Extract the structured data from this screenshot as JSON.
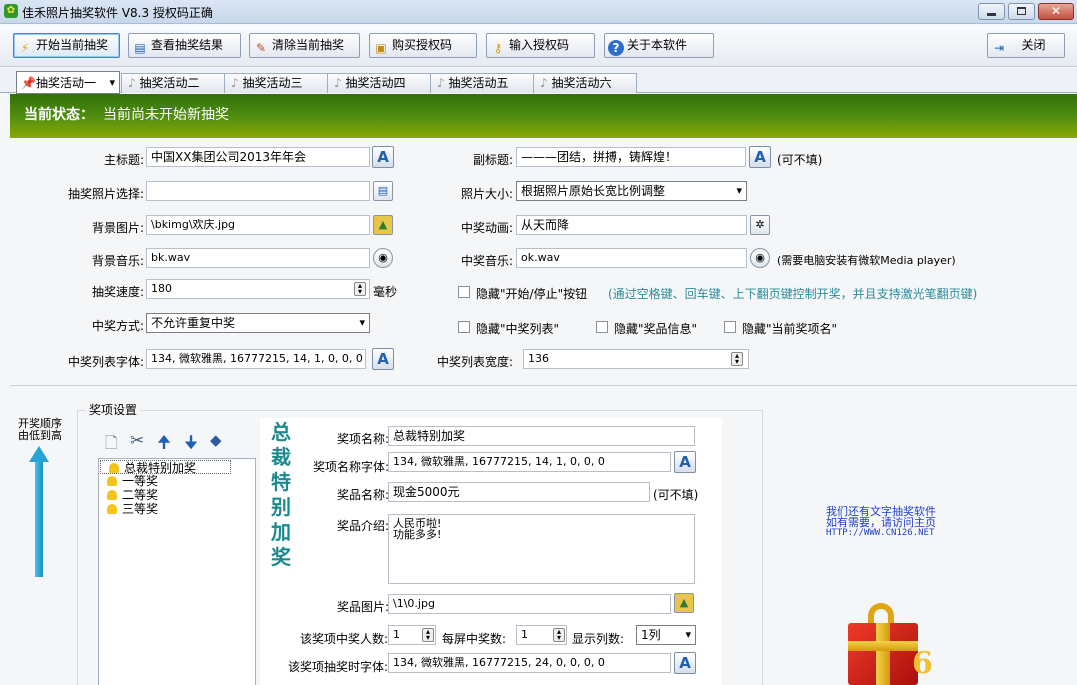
{
  "window": {
    "title": "佳禾照片抽奖软件 V8.3 授权码正确"
  },
  "toolbar": {
    "start": "开始当前抽奖",
    "view": "查看抽奖结果",
    "clear": "清除当前抽奖",
    "buy": "购买授权码",
    "enter": "输入授权码",
    "about": "关于本软件",
    "close": "关闭"
  },
  "tabs": [
    "抽奖活动一",
    "抽奖活动二",
    "抽奖活动三",
    "抽奖活动四",
    "抽奖活动五",
    "抽奖活动六"
  ],
  "status": {
    "label": "当前状态：",
    "value": "当前尚未开始新抽奖"
  },
  "form": {
    "main_title_label": "主标题:",
    "main_title": "中国XX集团公司2013年年会",
    "subtitle_label": "副标题:",
    "subtitle": "———团结，拼搏，铸辉煌！",
    "optional": "(可不填)",
    "photo_select_label": "抽奖照片选择:",
    "photo_select": "",
    "photo_size_label": "照片大小:",
    "photo_size": "根据照片原始长宽比例调整",
    "bg_image_label": "背景图片:",
    "bg_image": "\\bkimg\\欢庆.jpg",
    "anim_label": "中奖动画:",
    "anim": "从天而降",
    "bg_music_label": "背景音乐:",
    "bg_music": "bk.wav",
    "win_music_label": "中奖音乐:",
    "win_music": "ok.wav",
    "win_music_note": "(需要电脑安装有微软Media player)",
    "speed_label": "抽奖速度:",
    "speed": "180",
    "speed_unit": "毫秒",
    "hide_startstop": "隐藏\"开始/停止\"按钮",
    "hide_startstop_note": "(通过空格键、回车键、上下翻页键控制开奖，并且支持激光笔翻页键)",
    "win_mode_label": "中奖方式:",
    "win_mode": "不允许重复中奖",
    "hide_list": "隐藏\"中奖列表\"",
    "hide_prize_info": "隐藏\"奖品信息\"",
    "hide_current": "隐藏\"当前奖项名\"",
    "list_font_label": "中奖列表字体:",
    "list_font": "134, 微软雅黑, 16777215, 14, 1, 0, 0, 0",
    "list_width_label": "中奖列表宽度:",
    "list_width": "136"
  },
  "prize": {
    "order_label_1": "开奖顺序",
    "order_label_2": "由低到高",
    "group_title": "奖项设置",
    "items": [
      "总裁特别加奖",
      "一等奖",
      "二等奖",
      "三等奖"
    ],
    "big_title": [
      "总",
      "裁",
      "特",
      "别",
      "加",
      "奖"
    ],
    "name_label": "奖项名称:",
    "name": "总裁特别加奖",
    "name_font_label": "奖项名称字体:",
    "name_font": "134, 微软雅黑, 16777215, 14, 1, 0, 0, 0",
    "goods_label": "奖品名称:",
    "goods": "现金5000元",
    "optional": "(可不填)",
    "intro_label": "奖品介绍:",
    "intro_1": "人民币啦!",
    "intro_2": "功能多多!",
    "image_label": "奖品图片:",
    "image": "\\1\\0.jpg",
    "count_label": "该奖项中奖人数:",
    "count": "1",
    "per_screen_label": "每屏中奖数:",
    "per_screen": "1",
    "columns_label": "显示列数:",
    "columns": "1列",
    "draw_font_label": "该奖项抽奖时字体:",
    "draw_font": "134, 微软雅黑, 16777215, 24, 0, 0, 0, 0"
  },
  "promo": {
    "line1": "我们还有文字抽奖软件",
    "line2": "如有需要，请访问主页",
    "line3": "HTTP://WWW.CN126.NET"
  }
}
